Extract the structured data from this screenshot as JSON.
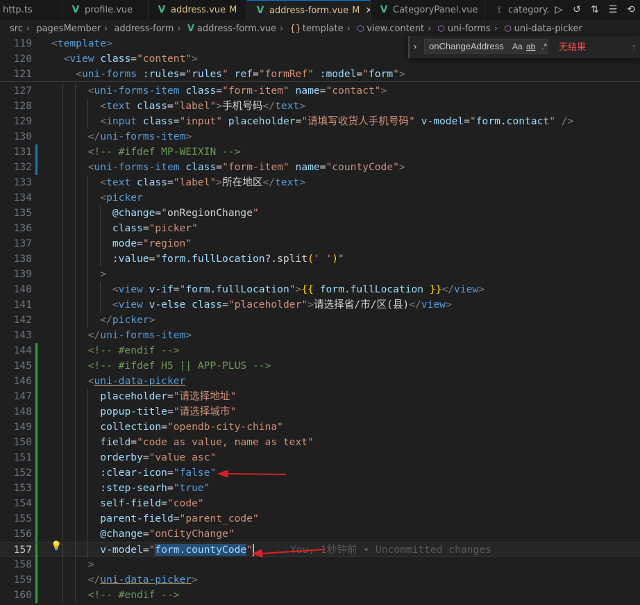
{
  "tabs": [
    {
      "label": "http.ts"
    },
    {
      "label": "profile.vue"
    },
    {
      "label": "address.vue",
      "mark": "M"
    },
    {
      "label": "address-form.vue",
      "mark": "M"
    },
    {
      "label": "CategoryPanel.vue"
    },
    {
      "label": "category.s"
    }
  ],
  "breadcrumb": [
    "src",
    "pagesMember",
    "address-form",
    "address-form.vue",
    "template",
    "view.content",
    "uni-forms",
    "uni-data-picker"
  ],
  "find": {
    "query": "onChangeAddress",
    "case_label": "Aa",
    "word_label": "ab",
    "regex_label": ".*",
    "result": "无结果"
  },
  "lines": {
    "l119": "119",
    "l120": "120",
    "l121": "121",
    "l127": "127",
    "l128": "128",
    "l129": "129",
    "l130": "130",
    "l131": "131",
    "l132": "132",
    "l133": "133",
    "l134": "134",
    "l135": "135",
    "l136": "136",
    "l137": "137",
    "l138": "138",
    "l139": "139",
    "l140": "140",
    "l141": "141",
    "l142": "142",
    "l143": "143",
    "l144": "144",
    "l145": "145",
    "l146": "146",
    "l147": "147",
    "l148": "148",
    "l149": "149",
    "l150": "150",
    "l151": "151",
    "l152": "152",
    "l153": "153",
    "l154": "154",
    "l155": "155",
    "l156": "156",
    "l157": "157",
    "l158": "158",
    "l159": "159",
    "l160": "160"
  },
  "code": {
    "c128_text": "手机号码",
    "c129_placeholder": "\"请填写收货人手机号码\"",
    "c133_text": "所在地区",
    "c141_text": "请选择省/市/区(县)",
    "c147_val": "\"请选择地址\"",
    "c148_val": "\"请选择城市\"",
    "c149_val": "\"opendb-city-china\"",
    "c150_val": "\"code as value, name as text\"",
    "c151_val": "\"value asc\"",
    "c152_val": "\"false\"",
    "c153_val": "\"true\"",
    "c154_val": "\"code\"",
    "c155_val": "\"parent_code\"",
    "c156_val": "\"onCityChange\"",
    "c157_val": "form.countyCode",
    "blame": "You, 1秒钟前 • Uncommitted changes"
  },
  "colors": {
    "accent": "#0078d4",
    "vue_icon": "#41b883",
    "annotation_arrow": "#e02020",
    "no_result": "#f14c4c"
  }
}
